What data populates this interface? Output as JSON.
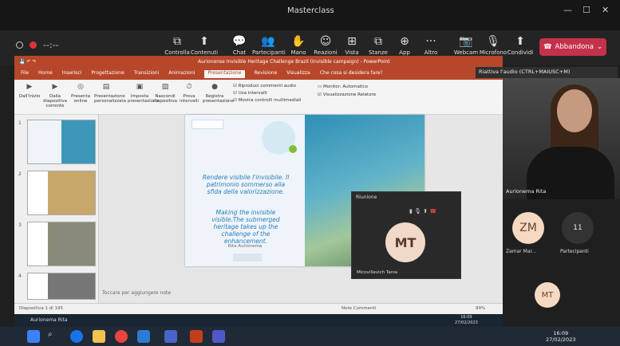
{
  "window": {
    "title": "Masterclass",
    "minimize": "—",
    "maximize": "☐",
    "close": "✕"
  },
  "meeting_timer": "--:--",
  "toolbar": {
    "items": [
      {
        "label": "Controlla",
        "icon": "⧉"
      },
      {
        "label": "Contenuti",
        "icon": "⬆"
      },
      {
        "label": "Chat",
        "icon": "💬"
      },
      {
        "label": "Partecipanti",
        "icon": "👥"
      },
      {
        "label": "Mano",
        "icon": "✋"
      },
      {
        "label": "Reazioni",
        "icon": "☺"
      },
      {
        "label": "Vista",
        "icon": "⊞"
      },
      {
        "label": "Stanze",
        "icon": "⧉"
      },
      {
        "label": "App",
        "icon": "⊕"
      },
      {
        "label": "Altro",
        "icon": "···"
      },
      {
        "label": "Webcam",
        "icon": "📷"
      },
      {
        "label": "Microfono",
        "icon": "🎙"
      },
      {
        "label": "Condividi",
        "icon": "⬆"
      }
    ],
    "leave_label": "Abbandona",
    "leave_color": "#c4314b"
  },
  "tooltip": "Riattiva l'audio (CTRL+MAIUSC+M)",
  "powerpoint": {
    "title": "Aurionense Invisible Heritage Challenge Brazil (Invisible campaign) - PowerPoint",
    "user": "Aurionense Rita",
    "tabs": [
      "File",
      "Home",
      "Inserisci",
      "Progettazione",
      "Transizioni",
      "Animazioni",
      "Presentazione",
      "Revisione",
      "Visualizza",
      "Che cosa si desidera fare?"
    ],
    "active_tab": "Presentazione",
    "ribbon": [
      "Dall'inizio",
      "Dalla diapositiva corrente",
      "Presenta online",
      "Presentazione personalizzata",
      "Imposta presentazione",
      "Nascondi diapositiva",
      "Prova intervalli",
      "Registra presentazione"
    ],
    "ribbon_checks": [
      "Riproduci commenti audio",
      "Usa intervalli",
      "Mostra controlli multimediali",
      "Monitor: Automatico",
      "Visualizzazione Relatore"
    ],
    "thumbnails": [
      "1",
      "2",
      "3",
      "4"
    ],
    "slide": {
      "text_it": "Rendere visibile l'invisibile. Il patrimonio sommerso alla sfida della valorizzazione.",
      "text_en": "Making the invisible visible.The submerged heritage takes up the challenge of the enhancement.",
      "author": "Rita Aurionema"
    },
    "notes_placeholder": "Toccare per aggiungere note",
    "status_left": "Diapositiva 1 di 195",
    "status_right": "Note   Commenti",
    "zoom": "99%"
  },
  "mini_window": {
    "title": "Riunione",
    "initials": "MT",
    "name": "Micovillevich Tania"
  },
  "participants": {
    "main_name": "Aurionema Rita",
    "zm_initials": "ZM",
    "zm_name": "Zamar Mar...",
    "others_count": "11",
    "others_label": "Partecipanti",
    "mt_initials": "MT"
  },
  "inner_taskbar": {
    "label": "Aurionema Rita",
    "time": "16:09",
    "date": "27/02/2023"
  },
  "taskbar": {
    "time": "16:09",
    "date": "27/02/2023"
  }
}
